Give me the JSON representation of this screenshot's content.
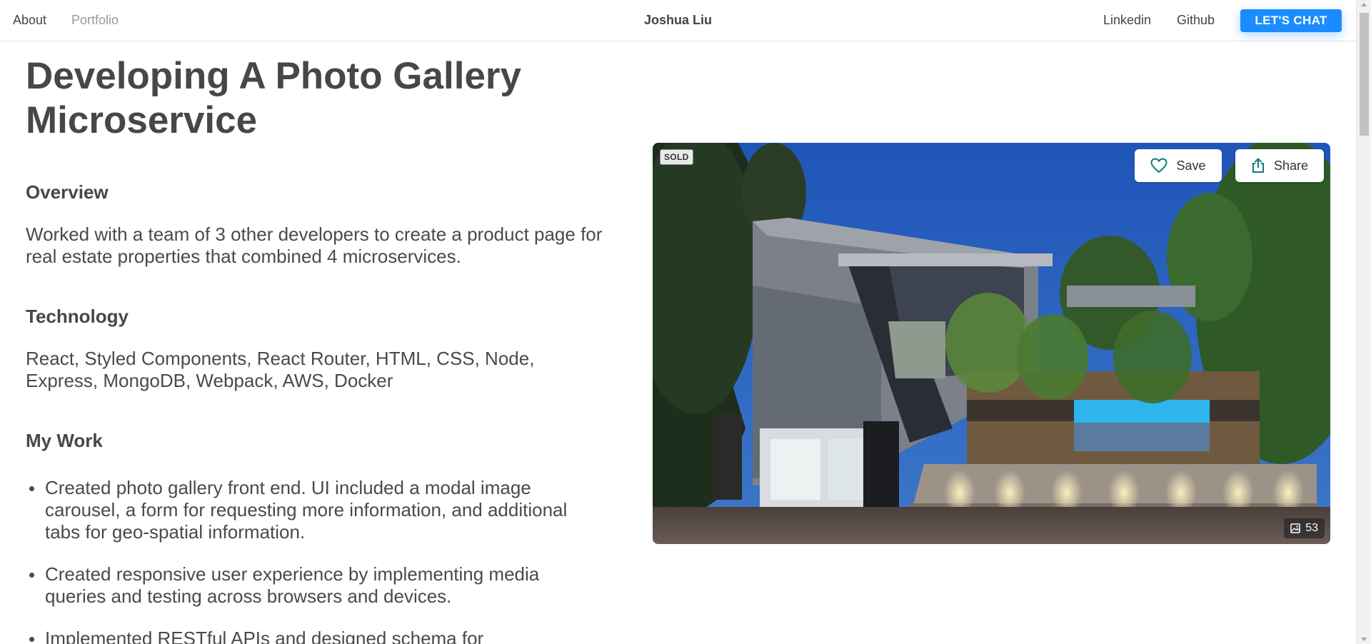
{
  "nav": {
    "about": "About",
    "portfolio": "Portfolio",
    "brand": "Joshua Liu",
    "linkedin": "Linkedin",
    "github": "Github",
    "cta": "LET'S CHAT"
  },
  "page": {
    "title": "Developing A Photo Gallery Microservice",
    "overview_heading": "Overview",
    "overview_text": "Worked with a team of 3 other developers to create a product page for real estate properties that combined 4 microservices.",
    "technology_heading": "Technology",
    "technology_text": "React, Styled Components, React Router, HTML, CSS, Node, Express, MongoDB, Webpack, AWS, Docker",
    "work_heading": "My Work",
    "work_items": [
      "Created photo gallery front end. UI included a modal image carousel, a form for requesting more information, and additional tabs for geo-spatial information.",
      "Created responsive user experience by implementing media queries and testing across browsers and devices.",
      "Implemented RESTful APIs and designed schema for"
    ]
  },
  "gallery": {
    "badge": "SOLD",
    "save_label": "Save",
    "share_label": "Share",
    "photo_count": "53",
    "save_icon": "heart-icon",
    "share_icon": "share-icon",
    "count_icon": "image-icon"
  },
  "colors": {
    "accent": "#1a8cff",
    "icon_teal": "#0e7c7b",
    "text": "#4a4a4a"
  }
}
